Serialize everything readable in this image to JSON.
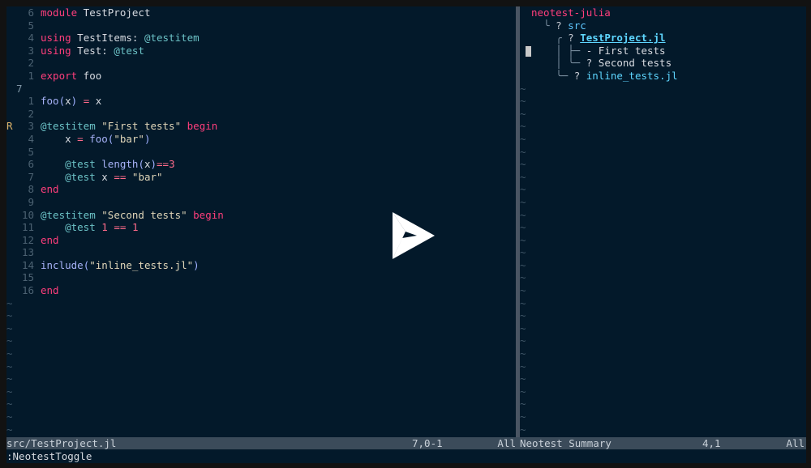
{
  "editor": {
    "lines": [
      {
        "sign": "",
        "num": "6",
        "parts": [
          [
            "kw",
            "module"
          ],
          [
            "ident",
            " TestProject"
          ]
        ]
      },
      {
        "sign": "",
        "num": "5",
        "parts": []
      },
      {
        "sign": "",
        "num": "4",
        "parts": [
          [
            "kw",
            "using"
          ],
          [
            "ident",
            " TestItems: "
          ],
          [
            "macro",
            "@testitem"
          ]
        ]
      },
      {
        "sign": "",
        "num": "3",
        "parts": [
          [
            "kw",
            "using"
          ],
          [
            "ident",
            " Test: "
          ],
          [
            "macro",
            "@test"
          ]
        ]
      },
      {
        "sign": "",
        "num": "2",
        "parts": []
      },
      {
        "sign": "",
        "num": "1",
        "parts": [
          [
            "kw",
            "export"
          ],
          [
            "ident",
            " foo"
          ]
        ]
      },
      {
        "sign": "",
        "num": "7",
        "current": true,
        "parts": []
      },
      {
        "sign": "",
        "num": "1",
        "parts": [
          [
            "fn",
            "foo"
          ],
          [
            "paren",
            "("
          ],
          [
            "ident",
            "x"
          ],
          [
            "paren",
            ")"
          ],
          [
            "ident",
            " "
          ],
          [
            "op",
            "="
          ],
          [
            "ident",
            " x"
          ]
        ]
      },
      {
        "sign": "",
        "num": "2",
        "parts": []
      },
      {
        "sign": "R",
        "num": "3",
        "parts": [
          [
            "macro",
            "@testitem"
          ],
          [
            "ident",
            " "
          ],
          [
            "str",
            "\"First tests\""
          ],
          [
            "ident",
            " "
          ],
          [
            "kw",
            "begin"
          ]
        ]
      },
      {
        "sign": "",
        "num": "4",
        "parts": [
          [
            "ident",
            "    x "
          ],
          [
            "op",
            "="
          ],
          [
            "ident",
            " "
          ],
          [
            "fn",
            "foo"
          ],
          [
            "paren",
            "("
          ],
          [
            "str",
            "\"bar\""
          ],
          [
            "paren",
            ")"
          ]
        ]
      },
      {
        "sign": "",
        "num": "5",
        "parts": []
      },
      {
        "sign": "",
        "num": "6",
        "parts": [
          [
            "ident",
            "    "
          ],
          [
            "macro",
            "@test"
          ],
          [
            "ident",
            " "
          ],
          [
            "fn",
            "length"
          ],
          [
            "paren",
            "("
          ],
          [
            "ident",
            "x"
          ],
          [
            "paren",
            ")"
          ],
          [
            "op",
            "=="
          ],
          [
            "num",
            "3"
          ]
        ]
      },
      {
        "sign": "",
        "num": "7",
        "parts": [
          [
            "ident",
            "    "
          ],
          [
            "macro",
            "@test"
          ],
          [
            "ident",
            " x "
          ],
          [
            "op",
            "=="
          ],
          [
            "ident",
            " "
          ],
          [
            "str",
            "\"bar\""
          ]
        ]
      },
      {
        "sign": "",
        "num": "8",
        "parts": [
          [
            "kw",
            "end"
          ]
        ]
      },
      {
        "sign": "",
        "num": "9",
        "parts": []
      },
      {
        "sign": "",
        "num": "10",
        "parts": [
          [
            "macro",
            "@testitem"
          ],
          [
            "ident",
            " "
          ],
          [
            "str",
            "\"Second tests\""
          ],
          [
            "ident",
            " "
          ],
          [
            "kw",
            "begin"
          ]
        ]
      },
      {
        "sign": "",
        "num": "11",
        "parts": [
          [
            "ident",
            "    "
          ],
          [
            "macro",
            "@test"
          ],
          [
            "ident",
            " "
          ],
          [
            "num",
            "1"
          ],
          [
            "ident",
            " "
          ],
          [
            "op",
            "=="
          ],
          [
            "ident",
            " "
          ],
          [
            "num",
            "1"
          ]
        ]
      },
      {
        "sign": "",
        "num": "12",
        "parts": [
          [
            "kw",
            "end"
          ]
        ]
      },
      {
        "sign": "",
        "num": "13",
        "parts": []
      },
      {
        "sign": "",
        "num": "14",
        "parts": [
          [
            "fn",
            "include"
          ],
          [
            "paren",
            "("
          ],
          [
            "str",
            "\"inline_tests.jl\""
          ],
          [
            "paren",
            ")"
          ]
        ]
      },
      {
        "sign": "",
        "num": "15",
        "parts": []
      },
      {
        "sign": "",
        "num": "16",
        "parts": [
          [
            "kw",
            "end"
          ]
        ]
      }
    ],
    "tilde_count": 11,
    "tilde": "~"
  },
  "summary": {
    "title": "neotest-julia",
    "tree": [
      {
        "prefix": "  ╰ ",
        "marker": "? ",
        "name": "src",
        "kind": "dir"
      },
      {
        "prefix": "    ╭ ",
        "marker": "? ",
        "name": "TestProject.jl",
        "kind": "file"
      },
      {
        "prefix": "    │ ├─ ",
        "marker": "- ",
        "name": "First tests",
        "kind": "test",
        "cursor": true
      },
      {
        "prefix": "    │ ╰─ ",
        "marker": "? ",
        "name": "Second tests",
        "kind": "test"
      },
      {
        "prefix": "    ╰─ ",
        "marker": "? ",
        "name": "inline_tests.jl",
        "kind": "file2"
      }
    ],
    "tilde_count": 28,
    "tilde": "~"
  },
  "status": {
    "left_file": "src/TestProject.jl",
    "left_pos": "7,0-1",
    "left_all": "All",
    "right_title": "Neotest Summary",
    "right_pos": "4,1",
    "right_all": "All"
  },
  "cmdline": ":NeotestToggle",
  "colors": {
    "background": "#03192a",
    "keyword": "#ff3e7c",
    "statusbar": "#3b4b5a",
    "play": "#ffffff"
  },
  "overlay": {
    "icon": "play-icon"
  }
}
